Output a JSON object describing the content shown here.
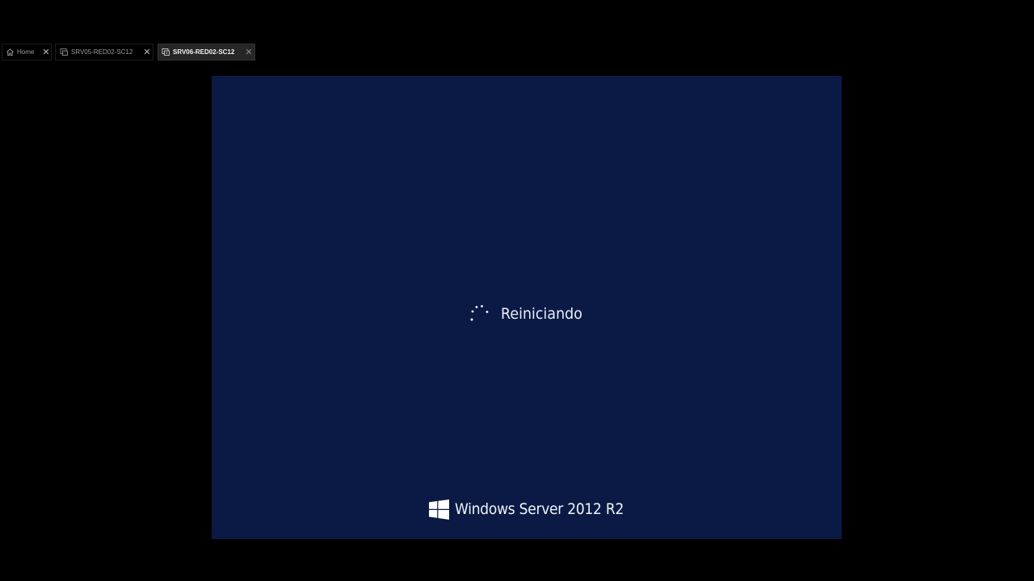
{
  "tabs": [
    {
      "label": "Home",
      "icon": "home-icon",
      "close": "✕",
      "active": false
    },
    {
      "label": "SRV05-RED02-SC12",
      "icon": "vm-icon",
      "close": "✕",
      "active": false
    },
    {
      "label": "SRV06-RED02-SC12",
      "icon": "vm-running-icon",
      "close": "✕",
      "active": true
    }
  ],
  "vm_screen": {
    "status_text": "Reiniciando",
    "brand_text": "Windows Server 2012 R2",
    "spinner_icon": "loading-spinner-icon",
    "logo_icon": "windows-logo-icon"
  },
  "colors": {
    "page_background": "#000000",
    "vm_background": "#0a1a45",
    "text": "#e8ecf5",
    "active_tab": "#262626",
    "vm_icon_accent": "#5cb85c"
  }
}
